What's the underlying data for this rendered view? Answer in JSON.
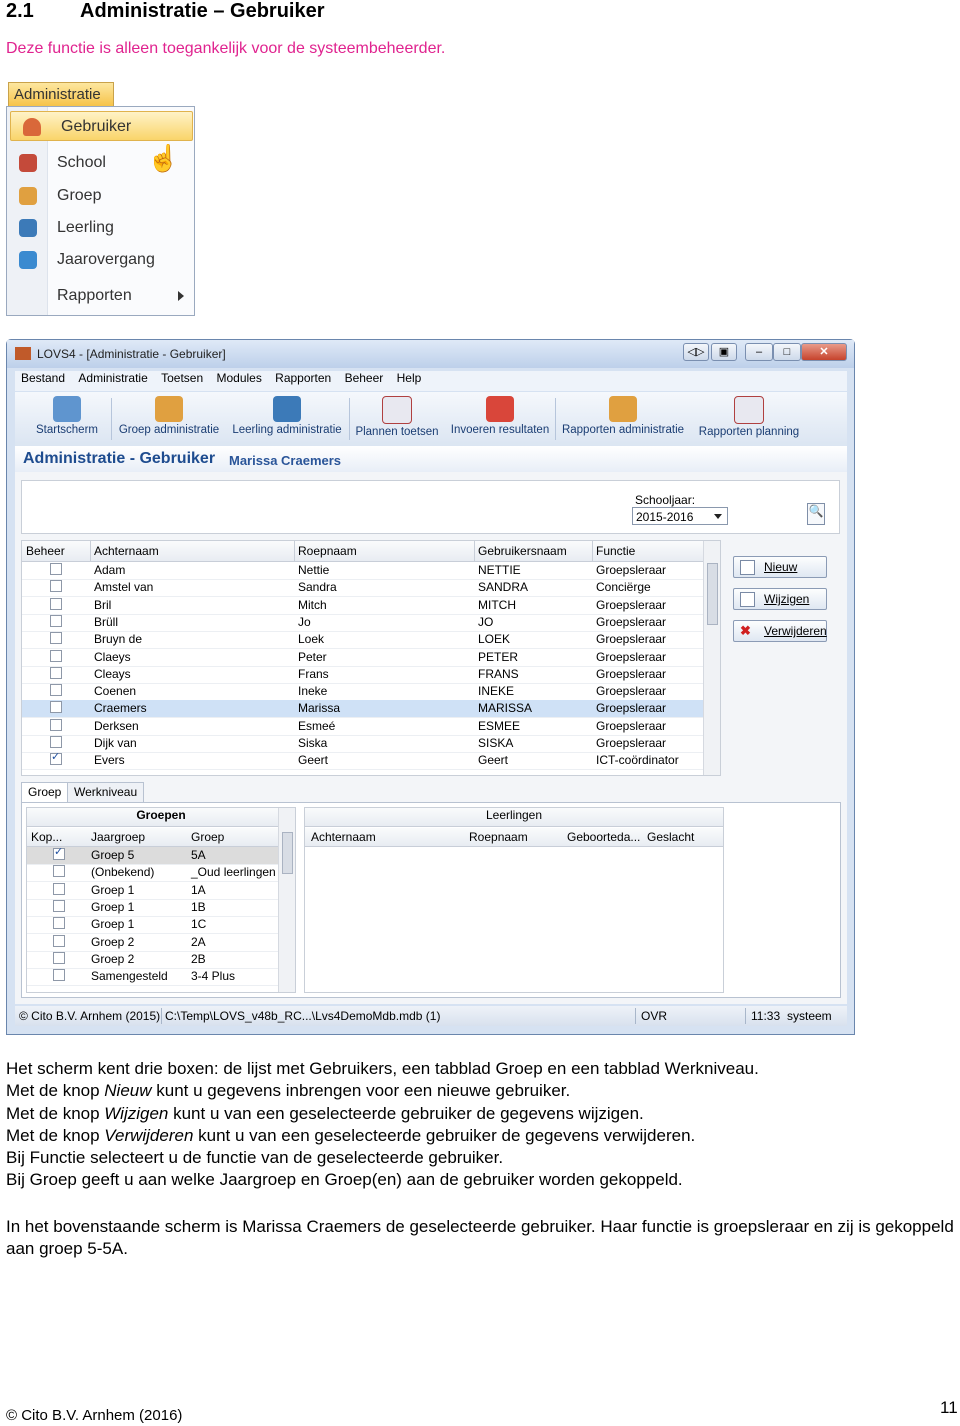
{
  "heading": {
    "number": "2.1",
    "title": "Administratie – Gebruiker"
  },
  "intro": "Deze functie is alleen toegankelijk voor de systeembeheerder.",
  "menu": {
    "tab": "Administratie",
    "items": [
      {
        "label": "Gebruiker",
        "icon": "user-icon",
        "selected": true
      },
      {
        "label": "School",
        "icon": "school-icon"
      },
      {
        "label": "Groep",
        "icon": "group-icon"
      },
      {
        "label": "Leerling",
        "icon": "student-icon"
      },
      {
        "label": "Jaarovergang",
        "icon": "year-transition-icon"
      },
      {
        "label": "Rapporten",
        "icon": "",
        "has_submenu": true
      }
    ]
  },
  "window": {
    "title": "LOVS4 - [Administratie - Gebruiker]",
    "menubar": [
      "Bestand",
      "Administratie",
      "Toetsen",
      "Modules",
      "Rapporten",
      "Beheer",
      "Help"
    ],
    "toolbar": [
      "Startscherm",
      "Groep administratie",
      "Leerling administratie",
      "Plannen toetsen",
      "Invoeren resultaten",
      "Rapporten administratie",
      "Rapporten planning"
    ],
    "section_title": "Administratie - Gebruiker",
    "current_user": "Marissa Craemers",
    "schooljaar_label": "Schooljaar:",
    "schooljaar_value": "2015-2016",
    "users_grid": {
      "columns": [
        "Beheer",
        "Achternaam",
        "Roepnaam",
        "Gebruikersnaam",
        "Functie"
      ],
      "rows": [
        {
          "beheer": false,
          "achternaam": "Adam",
          "roepnaam": "Nettie",
          "gebruikersnaam": "NETTIE",
          "functie": "Groepsleraar"
        },
        {
          "beheer": false,
          "achternaam": "Amstel van",
          "roepnaam": "Sandra",
          "gebruikersnaam": "SANDRA",
          "functie": "Conciërge"
        },
        {
          "beheer": false,
          "achternaam": "Bril",
          "roepnaam": "Mitch",
          "gebruikersnaam": "MITCH",
          "functie": "Groepsleraar"
        },
        {
          "beheer": false,
          "achternaam": "Brüll",
          "roepnaam": "Jo",
          "gebruikersnaam": "JO",
          "functie": "Groepsleraar"
        },
        {
          "beheer": false,
          "achternaam": "Bruyn de",
          "roepnaam": "Loek",
          "gebruikersnaam": "LOEK",
          "functie": "Groepsleraar"
        },
        {
          "beheer": false,
          "achternaam": "Claeys",
          "roepnaam": "Peter",
          "gebruikersnaam": "PETER",
          "functie": "Groepsleraar"
        },
        {
          "beheer": false,
          "achternaam": "Cleays",
          "roepnaam": "Frans",
          "gebruikersnaam": "FRANS",
          "functie": "Groepsleraar"
        },
        {
          "beheer": false,
          "achternaam": "Coenen",
          "roepnaam": "Ineke",
          "gebruikersnaam": "INEKE",
          "functie": "Groepsleraar"
        },
        {
          "beheer": false,
          "achternaam": "Craemers",
          "roepnaam": "Marissa",
          "gebruikersnaam": "MARISSA",
          "functie": "Groepsleraar",
          "selected": true
        },
        {
          "beheer": false,
          "achternaam": "Derksen",
          "roepnaam": "Esmeé",
          "gebruikersnaam": "ESMEE",
          "functie": "Groepsleraar"
        },
        {
          "beheer": false,
          "achternaam": "Dijk van",
          "roepnaam": "Siska",
          "gebruikersnaam": "SISKA",
          "functie": "Groepsleraar"
        },
        {
          "beheer": true,
          "achternaam": "Evers",
          "roepnaam": "Geert",
          "gebruikersnaam": "Geert",
          "functie": "ICT-coördinator"
        }
      ]
    },
    "buttons": {
      "nieuw": "Nieuw",
      "wijzigen": "Wijzigen",
      "verwijderen": "Verwijderen"
    },
    "tabs": [
      "Groep",
      "Werkniveau"
    ],
    "groepen": {
      "title": "Groepen",
      "columns": [
        "Kop...",
        "Jaargroep",
        "Groep"
      ],
      "rows": [
        {
          "checked": true,
          "jaargroep": "Groep 5",
          "groep": "5A",
          "selected": true
        },
        {
          "checked": false,
          "jaargroep": "(Onbekend)",
          "groep": "_Oud leerlingen"
        },
        {
          "checked": false,
          "jaargroep": "Groep 1",
          "groep": "1A"
        },
        {
          "checked": false,
          "jaargroep": "Groep 1",
          "groep": "1B"
        },
        {
          "checked": false,
          "jaargroep": "Groep 1",
          "groep": "1C"
        },
        {
          "checked": false,
          "jaargroep": "Groep 2",
          "groep": "2A"
        },
        {
          "checked": false,
          "jaargroep": "Groep 2",
          "groep": "2B"
        },
        {
          "checked": false,
          "jaargroep": "Samengesteld",
          "groep": "3-4 Plus"
        }
      ]
    },
    "leerlingen": {
      "title": "Leerlingen",
      "columns": [
        "Achternaam",
        "Roepnaam",
        "Geboorteda...",
        "Geslacht"
      ]
    },
    "statusbar": {
      "copyright": "© Cito B.V. Arnhem (2015)",
      "path": "C:\\Temp\\LOVS_v48b_RC...\\Lvs4DemoMdb.mdb (1)",
      "mode": "OVR",
      "time": "11:33",
      "user": "systeem"
    }
  },
  "body_lines": [
    "Het scherm kent drie boxen: de lijst met Gebruikers, een tabblad Groep en een tabblad Werkniveau.",
    "Met de knop Nieuw kunt u gegevens inbrengen voor een nieuwe gebruiker.",
    "Met de knop Wijzigen kunt u van een geselecteerde gebruiker de gegevens wijzigen.",
    "Met de knop Verwijderen kunt u van een geselecteerde gebruiker de gegevens verwijderen.",
    "Bij Functie selecteert u de functie van de geselecteerde gebruiker.",
    "Bij Groep geeft u aan welke Jaargroep en Groep(en) aan de gebruiker worden gekoppeld."
  ],
  "body_paragraph2": "In het bovenstaande scherm is Marissa Craemers de geselecteerde gebruiker. Haar functie is groepsleraar en zij is gekoppeld aan groep 5-5A.",
  "footer": {
    "copyright": "© Cito B.V. Arnhem (2016)",
    "page": "11"
  }
}
